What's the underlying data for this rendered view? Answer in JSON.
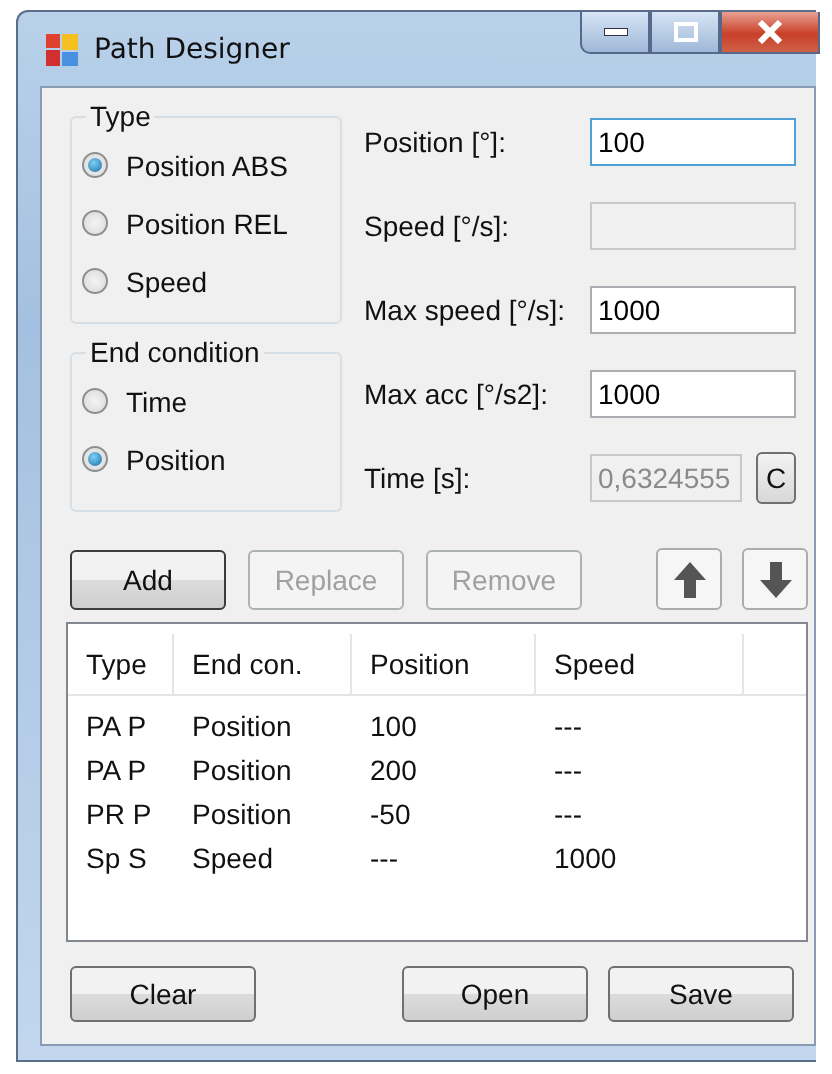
{
  "window": {
    "title": "Path Designer"
  },
  "type_group": {
    "title": "Type",
    "options": [
      {
        "label": "Position ABS",
        "selected": true
      },
      {
        "label": "Position REL",
        "selected": false
      },
      {
        "label": "Speed",
        "selected": false
      }
    ]
  },
  "end_condition_group": {
    "title": "End condition",
    "options": [
      {
        "label": "Time",
        "selected": false
      },
      {
        "label": "Position",
        "selected": true
      }
    ]
  },
  "fields": [
    {
      "label": "Position [°]:",
      "value": "100",
      "disabled": false,
      "focused": true
    },
    {
      "label": "Speed [°/s]:",
      "disabled": true,
      "focused": false
    },
    {
      "label": "Max speed [°/s]:",
      "value": "1000",
      "disabled": false,
      "focused": false
    },
    {
      "label": "Max acc [°/s2]:",
      "value": "1000",
      "disabled": false,
      "focused": false
    },
    {
      "label": "Time [s]:",
      "value": "0,6324555",
      "disabled": true,
      "focused": false,
      "button": "C"
    }
  ],
  "edit_buttons": [
    {
      "label": "Add",
      "disabled": false
    },
    {
      "label": "Replace",
      "disabled": true
    },
    {
      "label": "Remove",
      "disabled": true
    }
  ],
  "move_buttons": [
    {
      "kind": "up",
      "disabled": false
    },
    {
      "kind": "down",
      "disabled": false
    }
  ],
  "list": {
    "columns": [
      "Type",
      "End con.",
      "Position",
      "Speed"
    ],
    "rows": [
      [
        "PA P",
        "Position",
        "100",
        "---"
      ],
      [
        "PA P",
        "Position",
        "200",
        "---"
      ],
      [
        "PR P",
        "Position",
        "-50",
        "---"
      ],
      [
        "Sp S",
        "Speed",
        "---",
        "1000"
      ]
    ]
  },
  "bottom_buttons": [
    "Clear",
    "Open",
    "Save"
  ]
}
